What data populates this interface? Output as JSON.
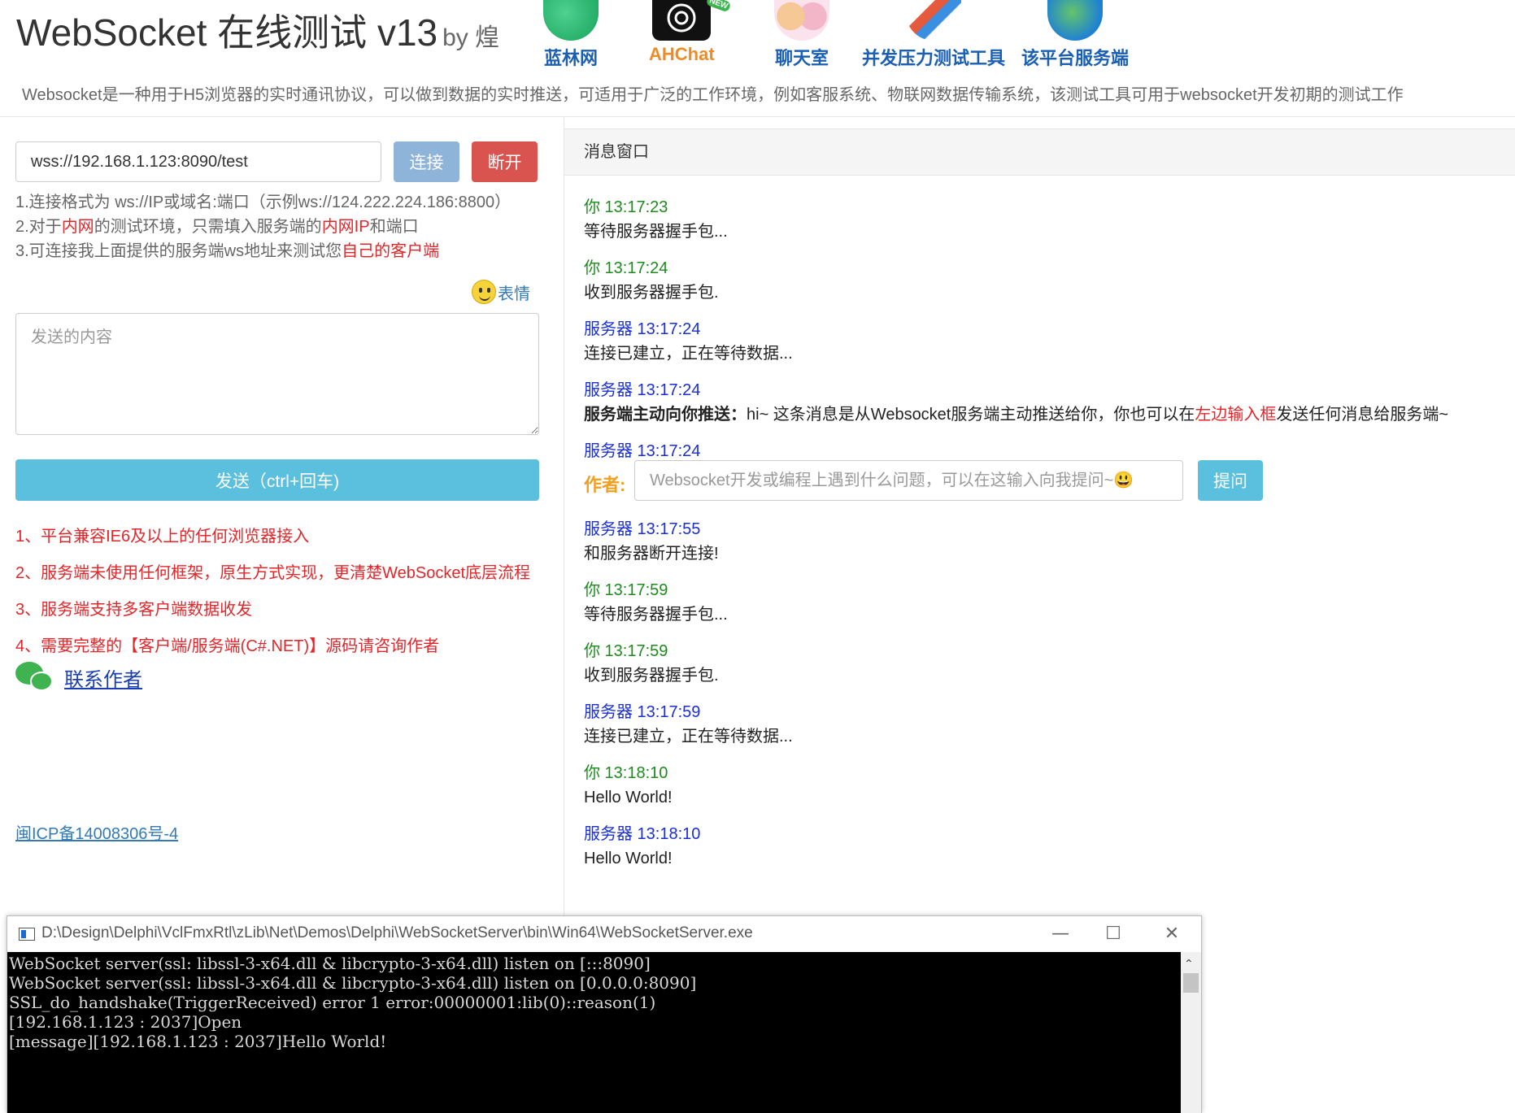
{
  "header": {
    "title": "WebSocket 在线测试 v13",
    "by": "by 煌",
    "nav": [
      {
        "label": "蓝林网",
        "icon": "globe-icon"
      },
      {
        "label": "AHChat",
        "icon": "openai-logo-icon"
      },
      {
        "label": "聊天室",
        "icon": "chat-people-icon"
      },
      {
        "label": "并发压力测试工具",
        "icon": "pencil-tool-icon"
      },
      {
        "label": "该平台服务端",
        "icon": "earth-icon"
      }
    ],
    "nav_new_badge": "NEW",
    "description": "Websocket是一种用于H5浏览器的实时通讯协议，可以做到数据的实时推送，可适用于广泛的工作环境，例如客服系统、物联网数据传输系统，该测试工具可用于websocket开发初期的测试工作"
  },
  "connection": {
    "url": "wss://192.168.1.123:8090/test",
    "connect_label": "连接",
    "disconnect_label": "断开"
  },
  "hints": {
    "line1": "1.连接格式为 ws://IP或域名:端口（示例ws://124.222.224.186:8800）",
    "line2_a": "2.对于",
    "line2_b": "内网",
    "line2_c": "的测试环境，只需填入服务端的",
    "line2_d": "内网IP",
    "line2_e": "和端口",
    "line3_a": "3.可连接我上面提供的服务端ws地址来测试您",
    "line3_b": "自己的客户端"
  },
  "emoji_label": "表情",
  "send": {
    "placeholder": "发送的内容",
    "button_label": "发送（ctrl+回车)"
  },
  "features": [
    "1、平台兼容IE6及以上的任何浏览器接入",
    "2、服务端未使用任何框架，原生方式实现，更清楚WebSocket底层流程",
    "3、服务端支持多客户端数据收发",
    "4、需要完整的【客户端/服务端(C#.NET)】源码请咨询作者"
  ],
  "contact_label": "联系作者",
  "icp": "闽ICP备14008306号-4",
  "message_window": {
    "title": "消息窗口",
    "messages": [
      {
        "meta": "你 13:17:23",
        "body": "等待服务器握手包..."
      },
      {
        "meta": "你 13:17:24",
        "body": "收到服务器握手包."
      },
      {
        "meta": "服务器 13:17:24",
        "body": "连接已建立，正在等待数据..."
      },
      {
        "meta": "服务器 13:17:24",
        "body_bold": "服务端主动向你推送：",
        "body_a": "hi~ 这条消息是从Websocket服务端主动推送给你，你也可以在",
        "body_red": "左边输入框",
        "body_b": "发送任何消息给服务端~"
      },
      {
        "meta": "服务器 13:17:24"
      },
      {
        "meta": "服务器 13:17:55",
        "body": "和服务器断开连接!"
      },
      {
        "meta": "你 13:17:59",
        "body": "等待服务器握手包..."
      },
      {
        "meta": "你 13:17:59",
        "body": "收到服务器握手包."
      },
      {
        "meta": "服务器 13:17:59",
        "body": "连接已建立，正在等待数据..."
      },
      {
        "meta": "你 13:18:10",
        "body": "Hello World!"
      },
      {
        "meta": "服务器 13:18:10",
        "body": "Hello World!"
      }
    ],
    "ask": {
      "label": "作者:",
      "placeholder": "Websocket开发或编程上遇到什么问题，可以在这输入向我提问~😃",
      "button_label": "提问"
    }
  },
  "console": {
    "title": "D:\\Design\\Delphi\\VclFmxRtl\\zLib\\Net\\Demos\\Delphi\\WebSocketServer\\bin\\Win64\\WebSocketServer.exe",
    "minimize": "—",
    "maximize": "☐",
    "close": "✕",
    "lines": [
      "WebSocket server(ssl: libssl-3-x64.dll & libcrypto-3-x64.dll) listen on [:::8090]",
      "WebSocket server(ssl: libssl-3-x64.dll & libcrypto-3-x64.dll) listen on [0.0.0.0:8090]",
      "SSL_do_handshake(TriggerReceived) error 1 error:00000001:lib(0)::reason(1)",
      "[192.168.1.123 : 2037]Open",
      "[message][192.168.1.123 : 2037]Hello World!"
    ]
  },
  "colors": {
    "you": "#1c8c1c",
    "server": "#1a2fd8",
    "accent_red": "#e4262a",
    "send_button": "#5bc0de",
    "connect_button": "#8fb4d9",
    "disconnect_button": "#d9534f"
  }
}
